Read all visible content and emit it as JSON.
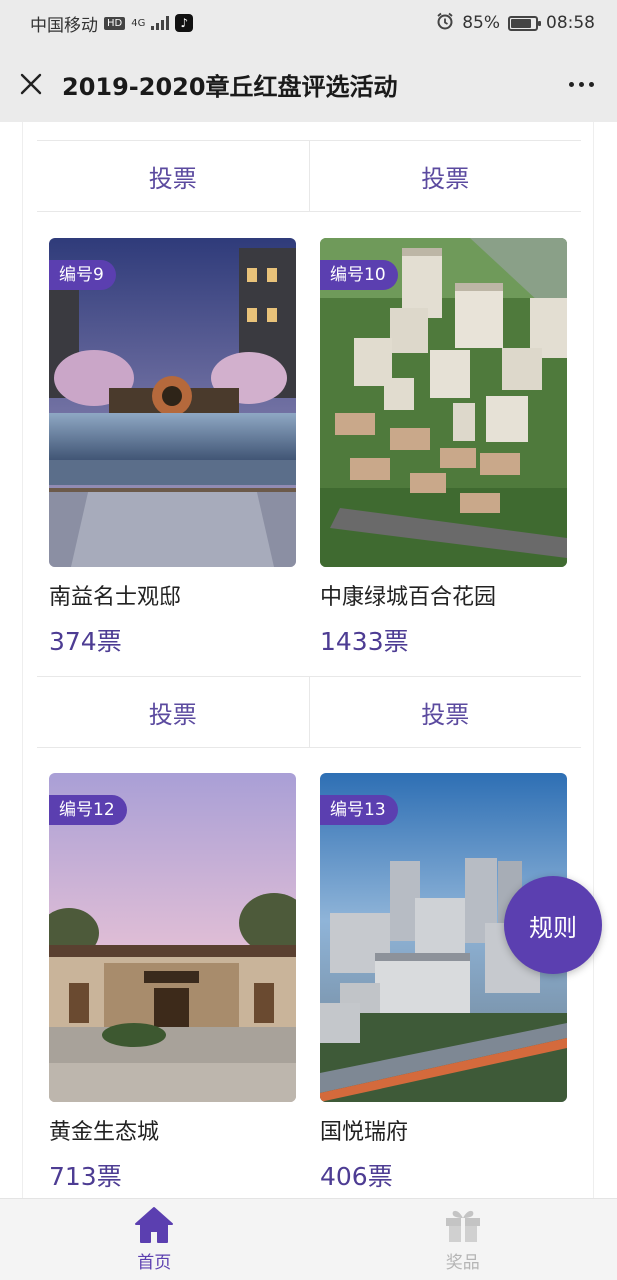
{
  "status_bar": {
    "carrier": "中国移动",
    "hd_badge": "HD",
    "network": "4G",
    "battery_percent": "85%",
    "time": "08:58"
  },
  "nav": {
    "title": "2019-2020章丘红盘评选活动"
  },
  "vote_label": "投票",
  "cards": [
    {
      "badge": "编号9",
      "name": "南益名士观邸",
      "votes": "374票"
    },
    {
      "badge": "编号10",
      "name": "中康绿城百合花园",
      "votes": "1433票"
    },
    {
      "badge": "编号12",
      "name": "黄金生态城",
      "votes": "713票"
    },
    {
      "badge": "编号13",
      "name": "国悦瑞府",
      "votes": "406票"
    }
  ],
  "rules_button": "规则",
  "tabs": [
    {
      "label": "首页",
      "icon": "home-icon",
      "active": true
    },
    {
      "label": "奖品",
      "icon": "gift-icon",
      "active": false
    }
  ],
  "colors": {
    "accent": "#5b3fb0",
    "vote_text": "#5b4a9f",
    "header_bg": "#ebebeb"
  }
}
